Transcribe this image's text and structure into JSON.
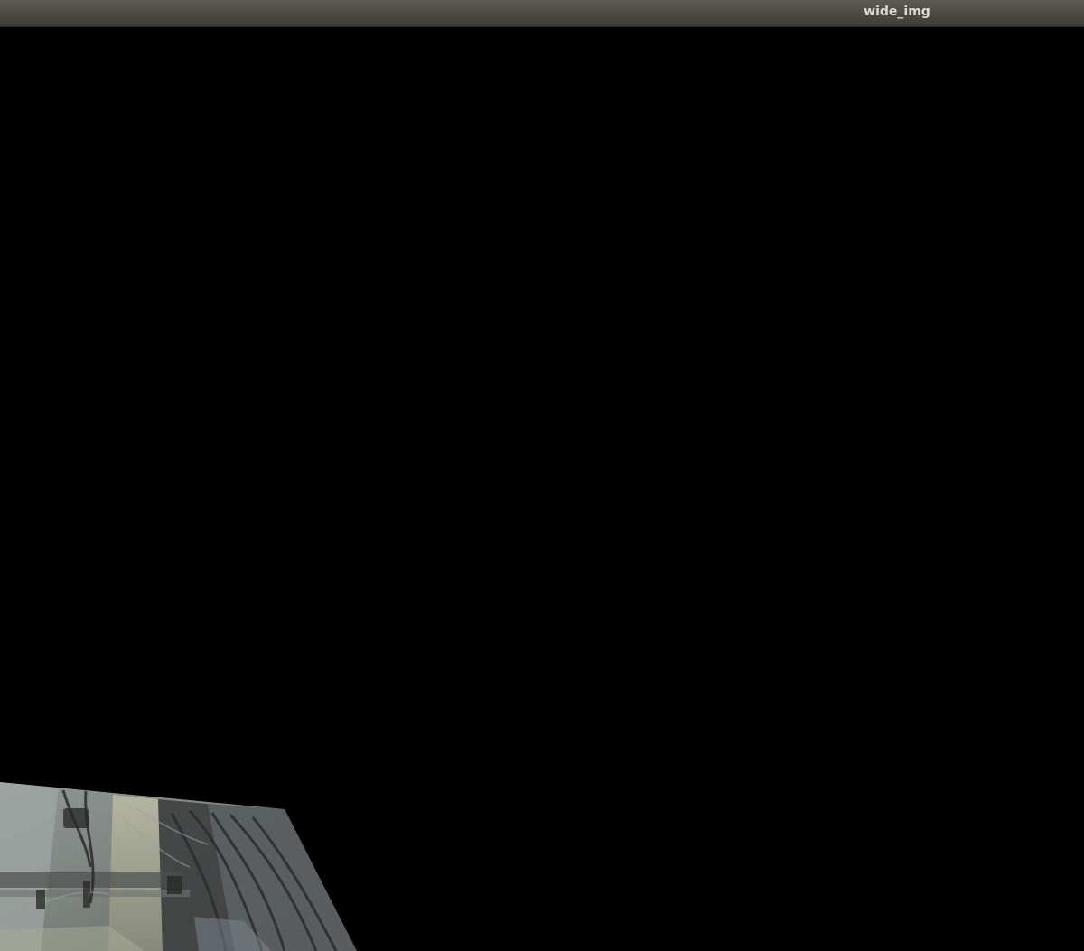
{
  "window": {
    "title": "wide_img"
  },
  "canvas": {
    "background_color": "#000000",
    "content_description_icon": "warped-camera-image-icon"
  },
  "colors": {
    "titlebar": "#4b4943",
    "title_text": "#dfdbd2",
    "background": "#000000"
  }
}
